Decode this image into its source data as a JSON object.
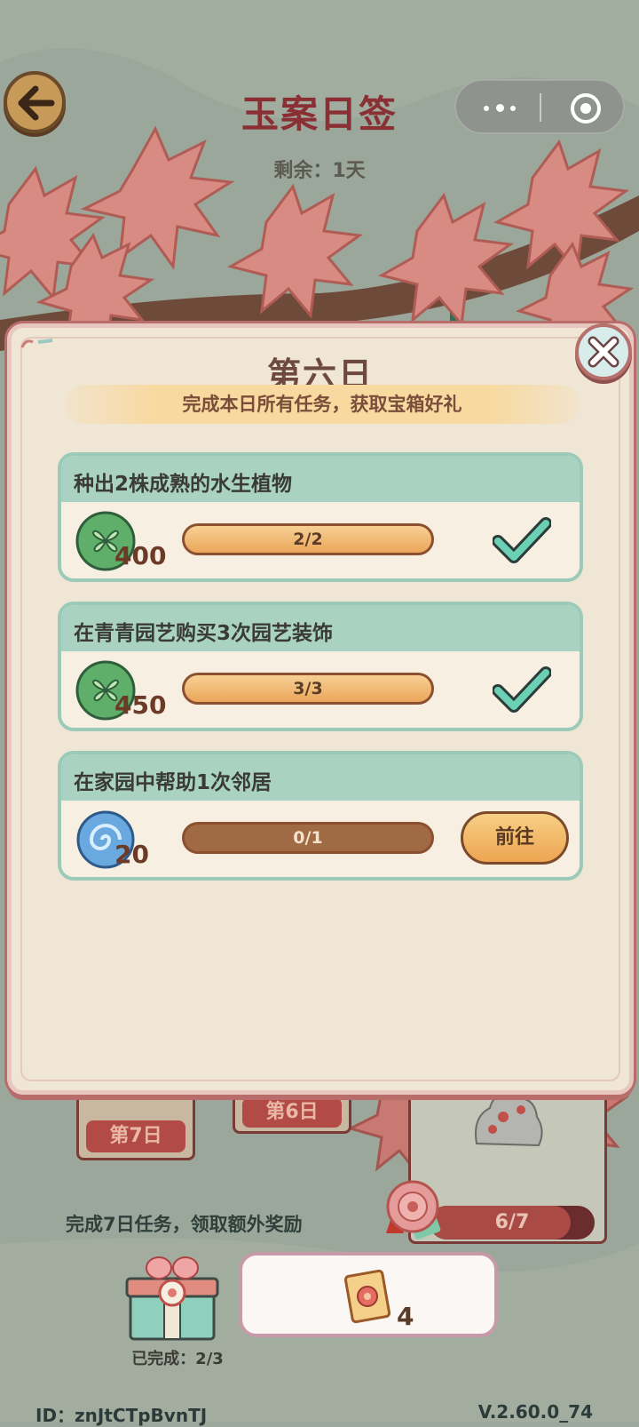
{
  "header": {
    "title": "玉案日签",
    "remaining": "剩余：1天"
  },
  "modal": {
    "title": "第六日",
    "subtitle": "完成本日所有任务，获取宝箱好礼",
    "tasks": [
      {
        "name": "种出2株成熟的水生植物",
        "reward_icon": "clover-coin-icon",
        "reward_qty": "400",
        "progress_text": "2/2",
        "progress": 1.0,
        "status": "done"
      },
      {
        "name": "在青青园艺购买3次园艺装饰",
        "reward_icon": "clover-coin-icon",
        "reward_qty": "450",
        "progress_text": "3/3",
        "progress": 1.0,
        "status": "done"
      },
      {
        "name": "在家园中帮助1次邻居",
        "reward_icon": "swirl-orb-icon",
        "reward_qty": "20",
        "progress_text": "0/1",
        "progress": 0.0,
        "status": "todo",
        "button_label": "前往"
      }
    ],
    "chest_completed": "已完成：2/3",
    "chest_reward_qty": "4"
  },
  "background": {
    "day_labels": [
      "第7日",
      "第6日"
    ],
    "bonus_text": "完成7日任务，领取额外奖励",
    "bonus_progress_text": "6/7",
    "bonus_progress": 0.857
  },
  "footer": {
    "id": "ID：znJtCTpBvnTJ",
    "version": "V.2.60.0_74"
  },
  "colors": {
    "title": "#8a2f33",
    "task_header": "#a9d2c3",
    "task_border": "#9ccab8",
    "bar_fill": "#eaa65a",
    "modal_bg": "#f0e6d6"
  }
}
